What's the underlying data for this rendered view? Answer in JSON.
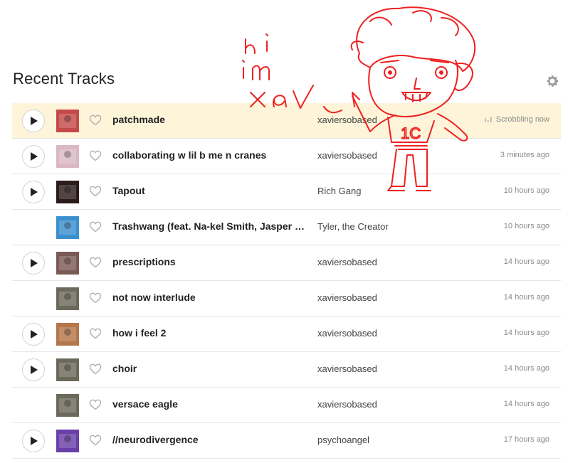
{
  "header": {
    "title": "Recent Tracks",
    "settings_icon": "gear-icon"
  },
  "tracks": [
    {
      "name": "patchmade",
      "artist": "xaviersobased",
      "time": "Scrobbling now",
      "playable": true,
      "now_playing": true,
      "art_color": "#c44a4a"
    },
    {
      "name": "collaborating w lil b me n cranes",
      "artist": "xaviersobased",
      "time": "3 minutes ago",
      "playable": true,
      "art_color": "#d9b8c4"
    },
    {
      "name": "Tapout",
      "artist": "Rich Gang",
      "time": "10 hours ago",
      "playable": true,
      "art_color": "#2b1b1b"
    },
    {
      "name": "Trashwang (feat. Na-kel Smith, Jasper Dol...",
      "artist": "Tyler, the Creator",
      "time": "10 hours ago",
      "playable": false,
      "art_color": "#3a8fcf"
    },
    {
      "name": "prescriptions",
      "artist": "xaviersobased",
      "time": "14 hours ago",
      "playable": true,
      "art_color": "#7a5a55"
    },
    {
      "name": "not now interlude",
      "artist": "xaviersobased",
      "time": "14 hours ago",
      "playable": false,
      "art_color": "#6b6a5a"
    },
    {
      "name": "how i feel 2",
      "artist": "xaviersobased",
      "time": "14 hours ago",
      "playable": true,
      "art_color": "#b5764a"
    },
    {
      "name": "choir",
      "artist": "xaviersobased",
      "time": "14 hours ago",
      "playable": true,
      "art_color": "#6b6a5a"
    },
    {
      "name": "versace eagle",
      "artist": "xaviersobased",
      "time": "14 hours ago",
      "playable": false,
      "art_color": "#6b6a5a"
    },
    {
      "name": "//neurodivergence",
      "artist": "psychoangel",
      "time": "17 hours ago",
      "playable": true,
      "art_color": "#6a3fa8"
    }
  ],
  "doodle": {
    "text_lines": [
      "h i",
      "i m",
      "x a V"
    ],
    "shirt_text": "1C",
    "color": "#ee2020"
  }
}
